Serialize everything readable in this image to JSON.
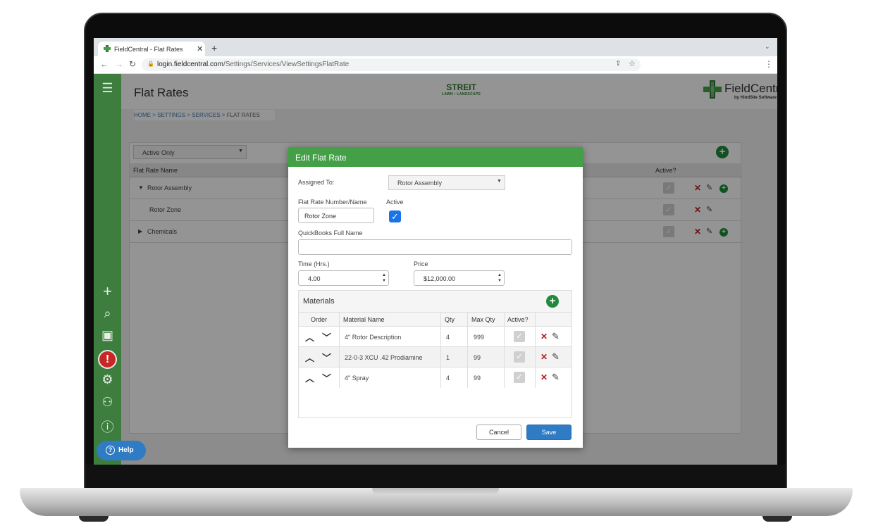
{
  "browser": {
    "tab_title": "FieldCentral - Flat Rates",
    "url_host": "login.fieldcentral.com",
    "url_path": "/Settings/Services/ViewSettingsFlatRate"
  },
  "header": {
    "page_title": "Flat Rates",
    "breadcrumb": [
      "HOME",
      "SETTINGS",
      "SERVICES",
      "FLAT RATES"
    ],
    "company_logo_main": "STREIT",
    "company_logo_sub": "LAWN • LANDSCAPE",
    "brand_name": "FieldCentral",
    "brand_by": "by HindSite Software"
  },
  "list": {
    "filter_value": "Active Only",
    "col_name": "Flat Rate Name",
    "col_active": "Active?",
    "rows": [
      {
        "name": "Rotor Assembly"
      },
      {
        "name": "Rotor Zone"
      },
      {
        "name": "Chemicals"
      }
    ]
  },
  "help_label": "Help",
  "modal": {
    "title": "Edit Flat Rate",
    "assigned_to_label": "Assigned To:",
    "assigned_to_value": "Rotor Assembly",
    "name_label": "Flat Rate Number/Name",
    "name_value": "Rotor Zone",
    "active_label": "Active",
    "active_checked": true,
    "qb_label": "QuickBooks Full Name",
    "qb_value": "",
    "time_label": "Time (Hrs.)",
    "time_value": "4.00",
    "price_label": "Price",
    "price_value": "$12,000.00",
    "materials_title": "Materials",
    "materials_headers": {
      "order": "Order",
      "name": "Material Name",
      "qty": "Qty",
      "max_qty": "Max Qty",
      "active": "Active?"
    },
    "materials": [
      {
        "name": "4\" Rotor Description",
        "qty": "4",
        "max_qty": "999",
        "active": true
      },
      {
        "name": "22-0-3 XCU .42 Prodiamine",
        "qty": "1",
        "max_qty": "99",
        "active": true
      },
      {
        "name": "4\" Spray",
        "qty": "4",
        "max_qty": "99",
        "active": true
      }
    ],
    "cancel_label": "Cancel",
    "save_label": "Save"
  },
  "colors": {
    "sidebar_green": "#3d7e3f",
    "modal_header_green": "#43a047",
    "primary_blue": "#2f7bc4",
    "delete_red": "#b71c1c"
  }
}
